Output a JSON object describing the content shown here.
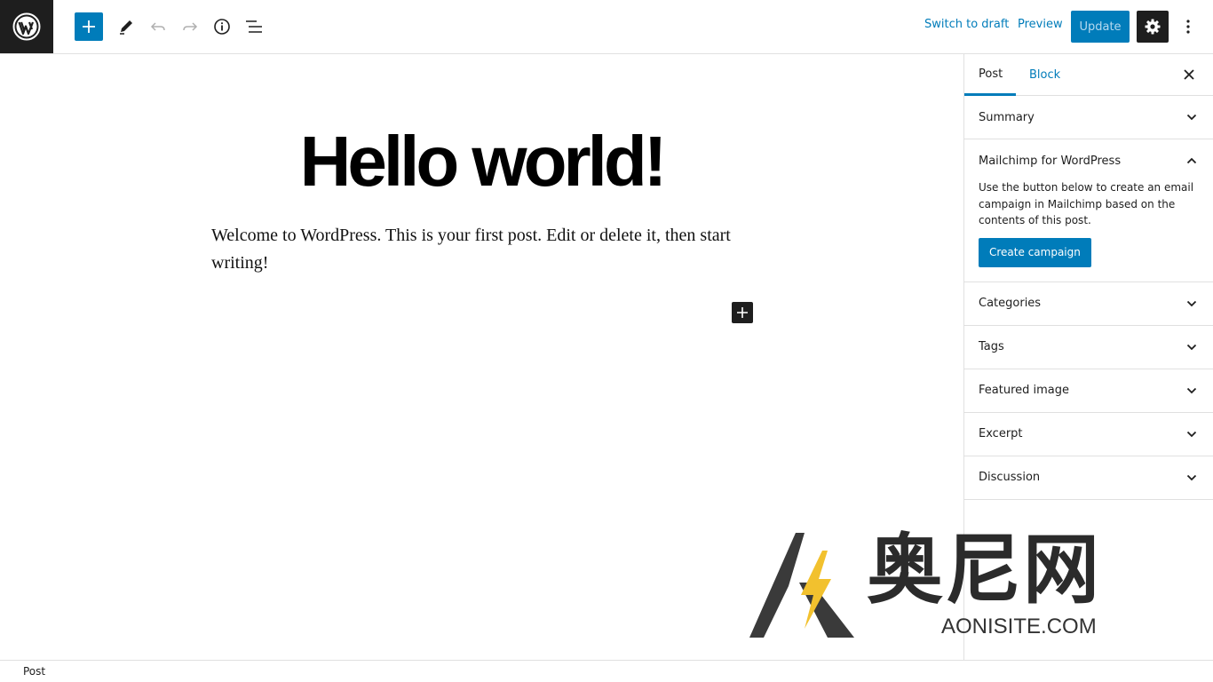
{
  "toolbar": {
    "switch_to_draft": "Switch to draft",
    "preview": "Preview",
    "update": "Update"
  },
  "post": {
    "title": "Hello world!",
    "content": "Welcome to WordPress. This is your first post. Edit or delete it, then start writing!"
  },
  "sidebar": {
    "tabs": [
      "Post",
      "Block"
    ],
    "panels": {
      "summary": "Summary",
      "mailchimp": {
        "title": "Mailchimp for WordPress",
        "description": "Use the button below to create an email campaign in Mailchimp based on the contents of this post.",
        "button": "Create campaign"
      },
      "categories": "Categories",
      "tags": "Tags",
      "featured_image": "Featured image",
      "excerpt": "Excerpt",
      "discussion": "Discussion"
    }
  },
  "footer": {
    "breadcrumb": "Post"
  },
  "watermark": {
    "text": "奥尼网",
    "subtext": "AONISITE.COM"
  },
  "colors": {
    "accent": "#007cba",
    "dark": "#1e1e1e",
    "border": "#e0e0e0"
  },
  "icons": [
    "wordpress-logo-icon",
    "plus-icon",
    "pencil-icon",
    "undo-icon",
    "redo-icon",
    "info-icon",
    "list-view-icon",
    "gear-icon",
    "more-vertical-icon",
    "close-icon",
    "chevron-down-icon",
    "chevron-up-icon"
  ]
}
